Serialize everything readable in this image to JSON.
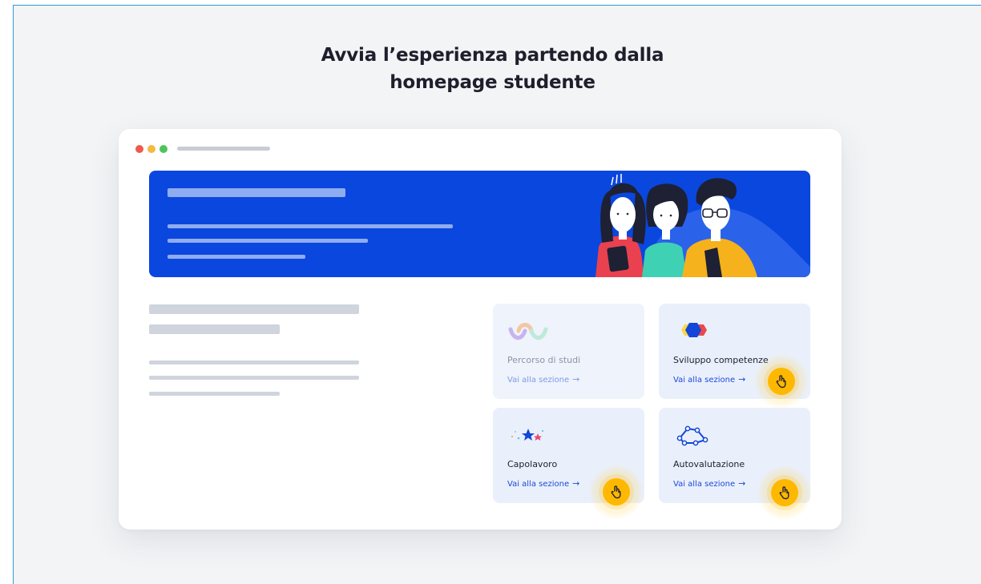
{
  "headline": {
    "line1": "Avvia l’esperienza partendo dalla",
    "line2": "homepage studente"
  },
  "window": {
    "traffic_lights": [
      "#f05a4f",
      "#f5b93f",
      "#4fc35b"
    ]
  },
  "cards": [
    {
      "title": "Percorso di studi",
      "link": "Vai alla sezione",
      "arrow": "→",
      "icon": "rainbow-waves-icon",
      "state": "muted"
    },
    {
      "title": "Sviluppo competenze",
      "link": "Vai alla sezione",
      "arrow": "→",
      "icon": "hexagons-icon",
      "state": "active"
    },
    {
      "title": "Capolavoro",
      "link": "Vai alla sezione",
      "arrow": "→",
      "icon": "stars-icon",
      "state": "active"
    },
    {
      "title": "Autovalutazione",
      "link": "Vai alla sezione",
      "arrow": "→",
      "icon": "network-nodes-icon",
      "state": "active"
    }
  ],
  "colors": {
    "hero_blue": "#0a47de",
    "hotspot_yellow": "#ffb800",
    "link_blue": "#1c49d9"
  }
}
